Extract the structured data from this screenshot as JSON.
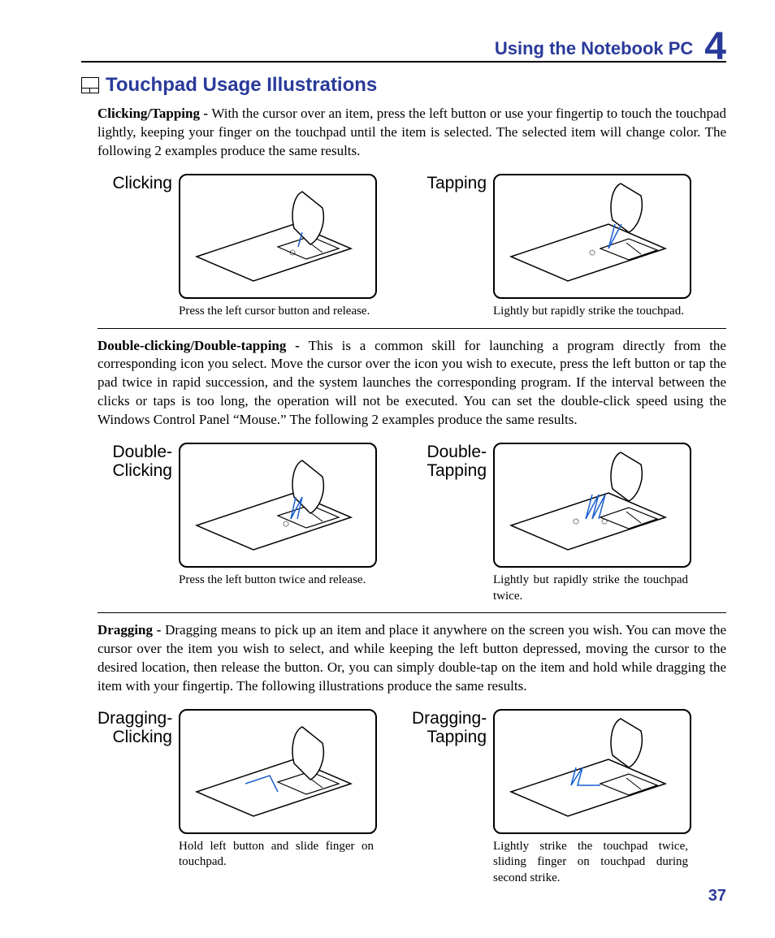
{
  "header": {
    "title": "Using the Notebook PC",
    "chapter": "4"
  },
  "section_title": "Touchpad Usage Illustrations",
  "page_number": "37",
  "para1": {
    "lead": "Clicking/Tapping - ",
    "text": "With the cursor over an item, press the left button or use your fingertip to touch the touchpad lightly, keeping your finger on the touchpad until the item is selected. The selected item will change color. The following 2 examples produce the same results."
  },
  "pair1": {
    "left_label": "Clicking",
    "left_caption": "Press the left cursor button and release.",
    "right_label": "Tapping",
    "right_caption": "Lightly but rapidly strike the touchpad."
  },
  "para2": {
    "lead": "Double-clicking/Double-tapping - ",
    "text": "This is a common skill for launching a program directly from the corresponding icon you select. Move the cursor over the icon you wish to execute, press the left button or tap the pad twice in rapid succession, and the system launches the corresponding program. If the interval between the clicks or taps is too long, the operation will not be executed. You can set the double-click speed using the Windows Control Panel “Mouse.” The following 2 examples produce the same results."
  },
  "pair2": {
    "left_label": "Double-\nClicking",
    "left_caption": "Press the left button twice and release.",
    "right_label": "Double-\nTapping",
    "right_caption": "Lightly but rapidly strike the touchpad twice."
  },
  "para3": {
    "lead": "Dragging - ",
    "text": "Dragging means to pick up an item and place it anywhere on the screen you wish. You can move the cursor over the item you wish to select, and while keeping the left button depressed, moving the cursor to the desired location, then release the button. Or, you can simply double-tap on the item and hold while dragging the item with your fingertip. The following illustrations produce the same results."
  },
  "pair3": {
    "left_label": "Dragging-\nClicking",
    "left_caption": "Hold left button and slide finger on touchpad.",
    "right_label": "Dragging-\nTapping",
    "right_caption": "Lightly strike the touchpad twice, sliding finger on touchpad during second strike."
  }
}
